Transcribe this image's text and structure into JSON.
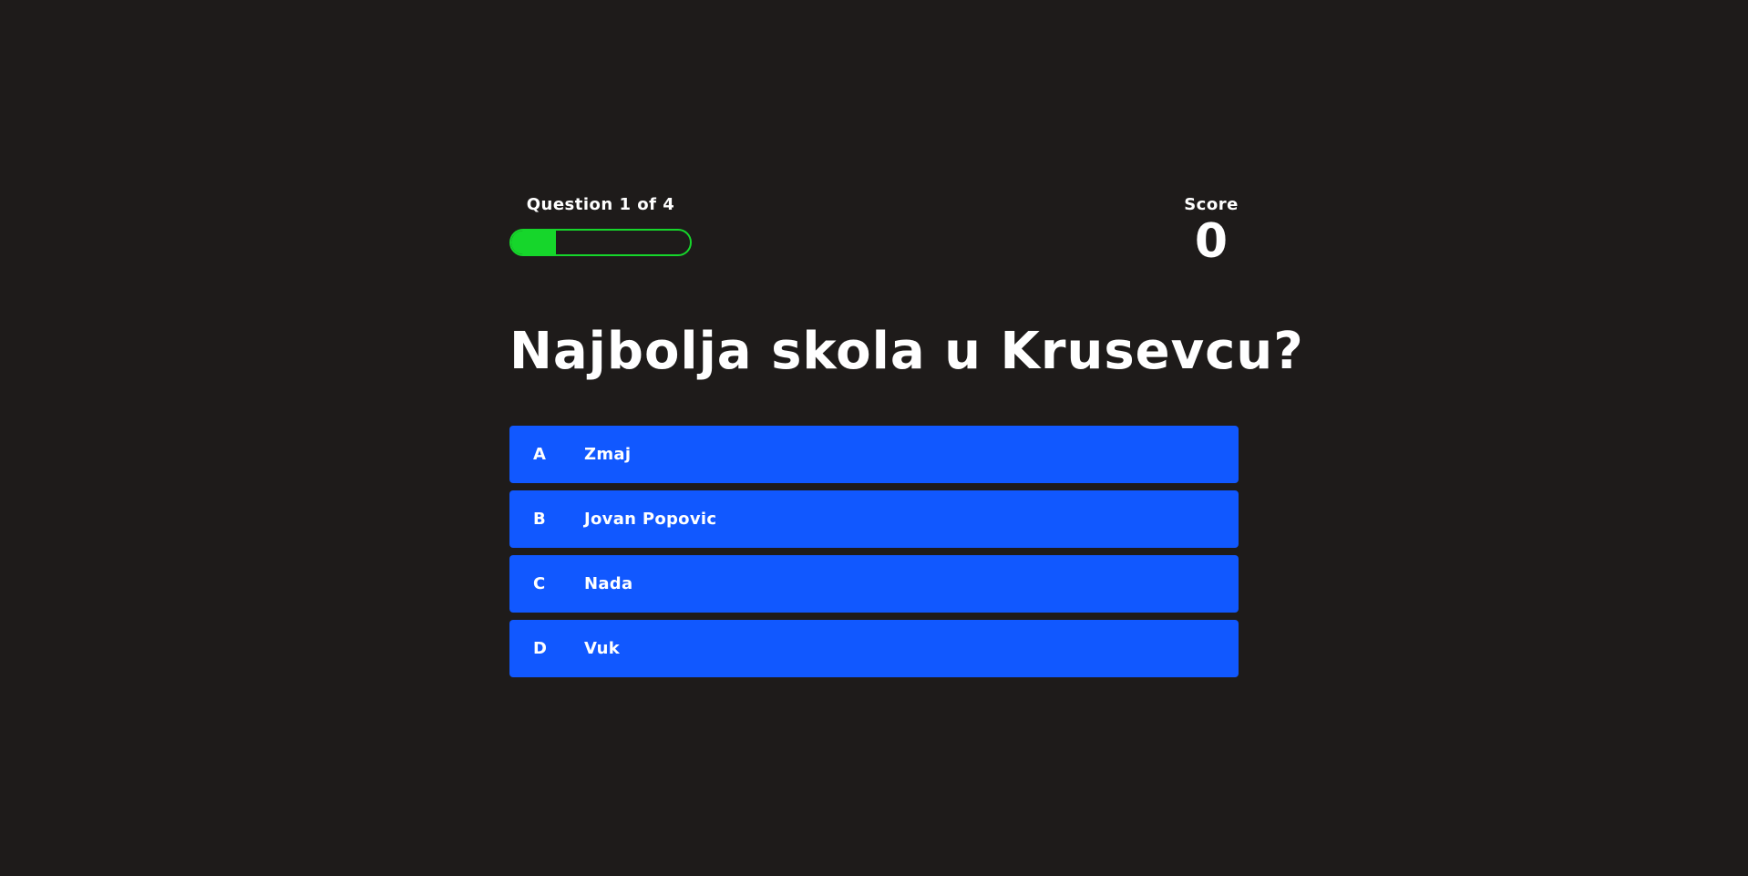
{
  "progress": {
    "label": "Question 1 of 4",
    "current": 1,
    "total": 4,
    "fraction": 0.25,
    "color": "#16d62b"
  },
  "score": {
    "label": "Score",
    "value": "0"
  },
  "question": {
    "text": "Najbolja skola u Krusevcu?"
  },
  "answers": [
    {
      "letter": "A",
      "text": "Zmaj"
    },
    {
      "letter": "B",
      "text": "Jovan Popovic"
    },
    {
      "letter": "C",
      "text": "Nada"
    },
    {
      "letter": "D",
      "text": "Vuk"
    }
  ],
  "colors": {
    "background": "#1e1b1a",
    "answer_bg": "#1158ff",
    "accent": "#16d62b"
  }
}
